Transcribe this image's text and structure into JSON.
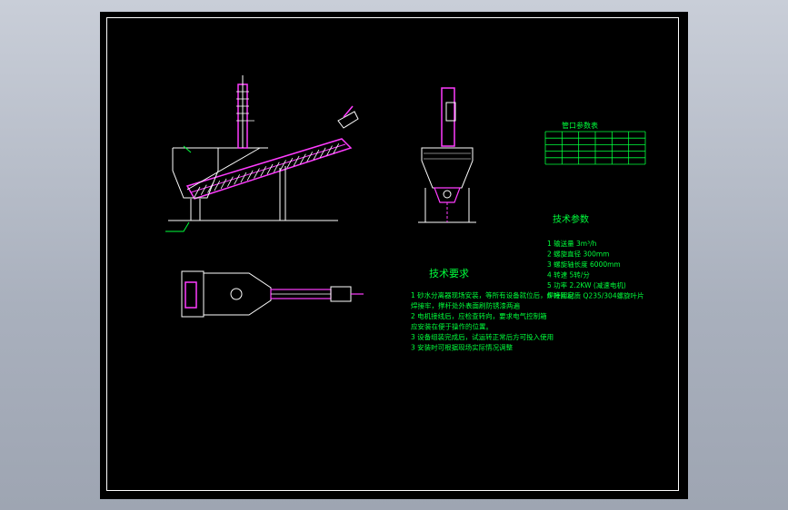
{
  "colors": {
    "background": "#a9b0bd",
    "sheet": "#000000",
    "frame": "#ffffff",
    "annotation": "#00ff3c",
    "machine_magenta": "#ff3cff",
    "machine_white": "#ffffff"
  },
  "table": {
    "title": "管口参数表",
    "rows": 5,
    "cols": 6
  },
  "specs": {
    "title": "技术参数",
    "items": [
      "1 输送量  3m³/h",
      "2 螺旋直径  300mm",
      "3 螺旋轴长度 6000mm",
      "4 转速  5转/分",
      "5 功率  2.2KW (减速电机)",
      "6 叶片材质 Q235/304螺旋叶片"
    ]
  },
  "requirements": {
    "title": "技术要求",
    "lines": [
      "1 砂水分离器现场安装，等所有设备就位后，焊接固定",
      "焊接牢，撑杆处外表面刷防锈漆两遍",
      "2 电机接线后，应检查转向，要求电气控制箱",
      "应安装在便于操作的位置。",
      "3 设备组装完成后，试运转正常后方可投入使用",
      "3 安装时可根据现场实际情况调整"
    ]
  }
}
